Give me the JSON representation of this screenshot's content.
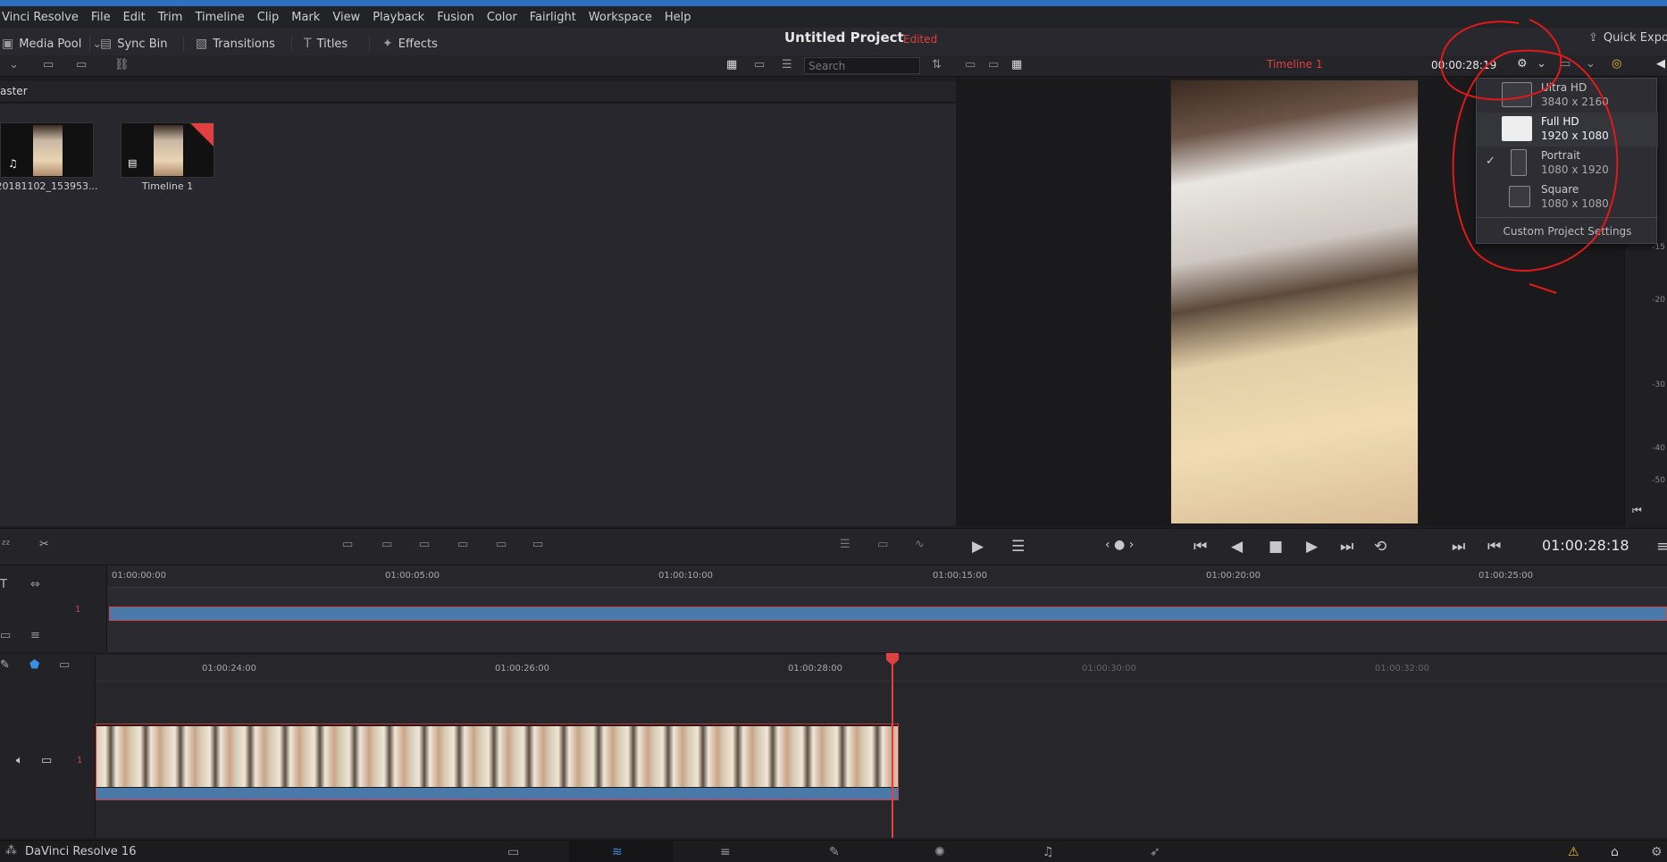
{
  "menu": [
    "Vinci Resolve",
    "File",
    "Edit",
    "Trim",
    "Timeline",
    "Clip",
    "Mark",
    "View",
    "Playback",
    "Fusion",
    "Color",
    "Fairlight",
    "Workspace",
    "Help"
  ],
  "toolbar": {
    "media_pool": "Media Pool",
    "sync_bin": "Sync Bin",
    "transitions": "Transitions",
    "titles": "Titles",
    "effects": "Effects",
    "quick_export": "Quick Expo"
  },
  "project": {
    "title": "Untitled Project",
    "status": "Edited"
  },
  "media_pool": {
    "search_placeholder": "Search",
    "bin_name": "aster",
    "clips": [
      {
        "label": "20181102_153953..."
      },
      {
        "label": "Timeline 1"
      }
    ]
  },
  "viewer": {
    "timeline_name": "Timeline 1",
    "timecode": "00:00:28:19",
    "meter_ticks": [
      "-15",
      "-20",
      "-30",
      "-40",
      "-50"
    ]
  },
  "resolution_menu": {
    "items": [
      {
        "name": "Ultra HD",
        "size": "3840 x 2160",
        "checked": false
      },
      {
        "name": "Full HD",
        "size": "1920 x 1080",
        "checked": false
      },
      {
        "name": "Portrait",
        "size": "1080 x 1920",
        "checked": true
      },
      {
        "name": "Square",
        "size": "1080 x 1080",
        "checked": false
      }
    ],
    "custom": "Custom Project Settings",
    "check_glyph": "✓"
  },
  "transport": {
    "timecode": "01:00:28:18"
  },
  "upper_ruler": [
    "01:00:00:00",
    "01:00:05:00",
    "01:00:10:00",
    "01:00:15:00",
    "01:00:20:00",
    "01:00:25:00"
  ],
  "lower_ruler": [
    "01:00:24:00",
    "01:00:26:00",
    "01:00:28:00",
    "01:00:30:00",
    "01:00:32:00"
  ],
  "track_numbers": {
    "upper": "1",
    "lower": "1"
  },
  "status": {
    "app": "DaVinci Resolve 16"
  }
}
